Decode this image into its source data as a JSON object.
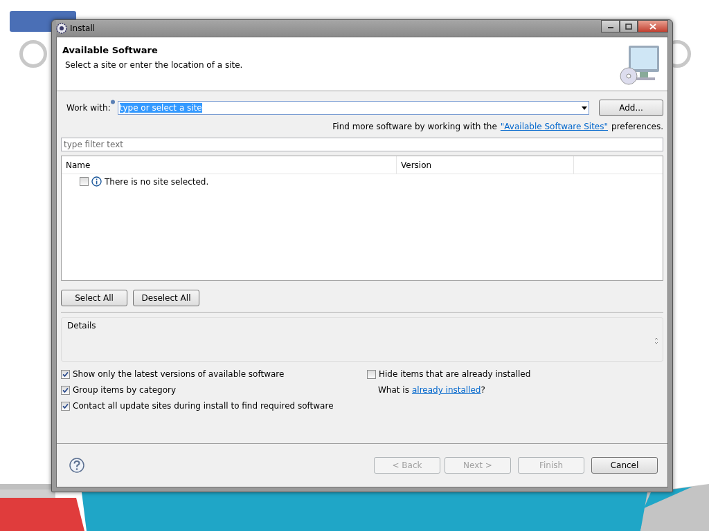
{
  "window": {
    "title": "Install",
    "header": {
      "title": "Available Software",
      "subtitle": "Select a site or enter the location of a site."
    }
  },
  "work_with": {
    "label": "Work with:",
    "value": "type or select a site",
    "value_selected": true,
    "button": "Add..."
  },
  "more_info": {
    "before": "Find more software by working with the",
    "link": "\"Available Software Sites\"",
    "after": "preferences."
  },
  "filter": {
    "placeholder": "type filter text"
  },
  "table": {
    "columns": [
      "Name",
      "Version"
    ],
    "rows": [
      {
        "checked": false,
        "text": "There is no site selected."
      }
    ]
  },
  "selection_buttons": [
    "Select All",
    "Deselect All"
  ],
  "details": {
    "title": "Details"
  },
  "options_left": [
    {
      "label": "Show only the latest versions of available software",
      "checked": true
    },
    {
      "label": "Group items by category",
      "checked": true
    },
    {
      "label": "Contact all update sites during install to find required software",
      "checked": true
    }
  ],
  "options_right": {
    "hide_installed": {
      "label": "Hide items that are already installed",
      "checked": false
    },
    "what_is": {
      "before": "What is",
      "link": "already installed",
      "after": "?"
    }
  },
  "footer_buttons": [
    {
      "label": "< Back",
      "disabled": true
    },
    {
      "label": "Next >",
      "disabled": true
    },
    {
      "label": "Finish",
      "disabled": true
    },
    {
      "label": "Cancel",
      "disabled": false
    }
  ]
}
